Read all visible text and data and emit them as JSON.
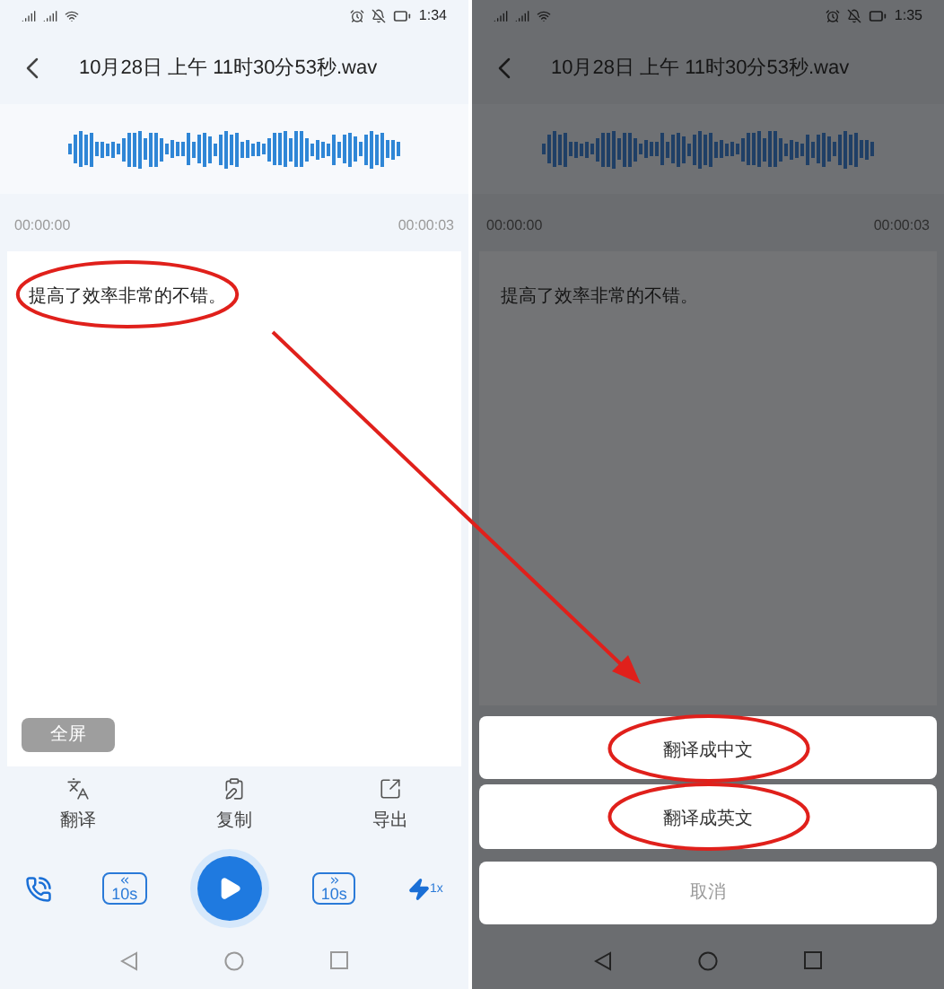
{
  "screens": [
    {
      "status_bar": {
        "time": "1:34"
      },
      "title": "10月28日 上午 11时30分53秒.wav",
      "start_time": "00:00:00",
      "end_time": "00:00:03",
      "transcript": {
        "text": "提高了效率非常的不错。",
        "circled": true
      },
      "fullscreen_button": "全屏",
      "actions": [
        {
          "label": "翻译",
          "kind": "translate"
        },
        {
          "label": "复制",
          "kind": "copy"
        },
        {
          "label": "导出",
          "kind": "export"
        }
      ],
      "player": {
        "rewind_label": "10s",
        "forward_label": "10s",
        "speed_label": "1x"
      }
    },
    {
      "status_bar": {
        "time": "1:35"
      },
      "title": "10月28日 上午 11时30分53秒.wav",
      "start_time": "00:00:00",
      "end_time": "00:00:03",
      "transcript": {
        "text": "提高了效率非常的不错。",
        "circled": false
      },
      "sheet": {
        "options": [
          {
            "label": "翻译成中文",
            "circled": true
          },
          {
            "label": "翻译成英文",
            "circled": true
          }
        ],
        "cancel": "取消"
      }
    }
  ]
}
